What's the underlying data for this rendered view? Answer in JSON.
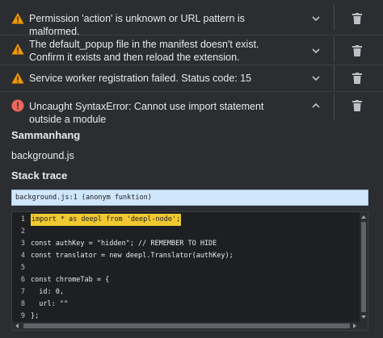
{
  "errors": [
    {
      "icon": "warning-icon",
      "message": "Permission 'action' is unknown or URL pattern is malformed.",
      "expanded": false
    },
    {
      "icon": "warning-icon",
      "message": "The default_popup file in the manifest doesn't exist. Confirm it exists and then reload the extension.",
      "expanded": false
    },
    {
      "icon": "warning-icon",
      "message": "Service worker registration failed. Status code: 15",
      "expanded": false
    },
    {
      "icon": "error-icon",
      "message": "Uncaught SyntaxError: Cannot use import statement outside a module",
      "expanded": true
    }
  ],
  "details": {
    "context_title": "Sammanhang",
    "context_value": "background.js",
    "stack_title": "Stack trace",
    "stack_entry": "background.js:1 (anonym funktion)"
  },
  "code": {
    "lines": [
      {
        "num": "1",
        "text": "import * as deepl from 'deepl-node';",
        "highlight": true
      },
      {
        "num": "2",
        "text": "",
        "highlight": false
      },
      {
        "num": "3",
        "text": "const authKey = \"hidden\"; // REMEMBER TO HIDE",
        "highlight": false
      },
      {
        "num": "4",
        "text": "const translator = new deepl.Translator(authKey);",
        "highlight": false
      },
      {
        "num": "5",
        "text": "",
        "highlight": false
      },
      {
        "num": "6",
        "text": "const chromeTab = {",
        "highlight": false
      },
      {
        "num": "7",
        "text": "  id: 0,",
        "highlight": false
      },
      {
        "num": "8",
        "text": "  url: \"\"",
        "highlight": false
      },
      {
        "num": "9",
        "text": "};",
        "highlight": false
      }
    ]
  },
  "colors": {
    "background": "#2b2d30",
    "warning": "#f29900",
    "error": "#ee675c",
    "stack_highlight": "#cfe6fb",
    "code_highlight": "#f0c930"
  }
}
